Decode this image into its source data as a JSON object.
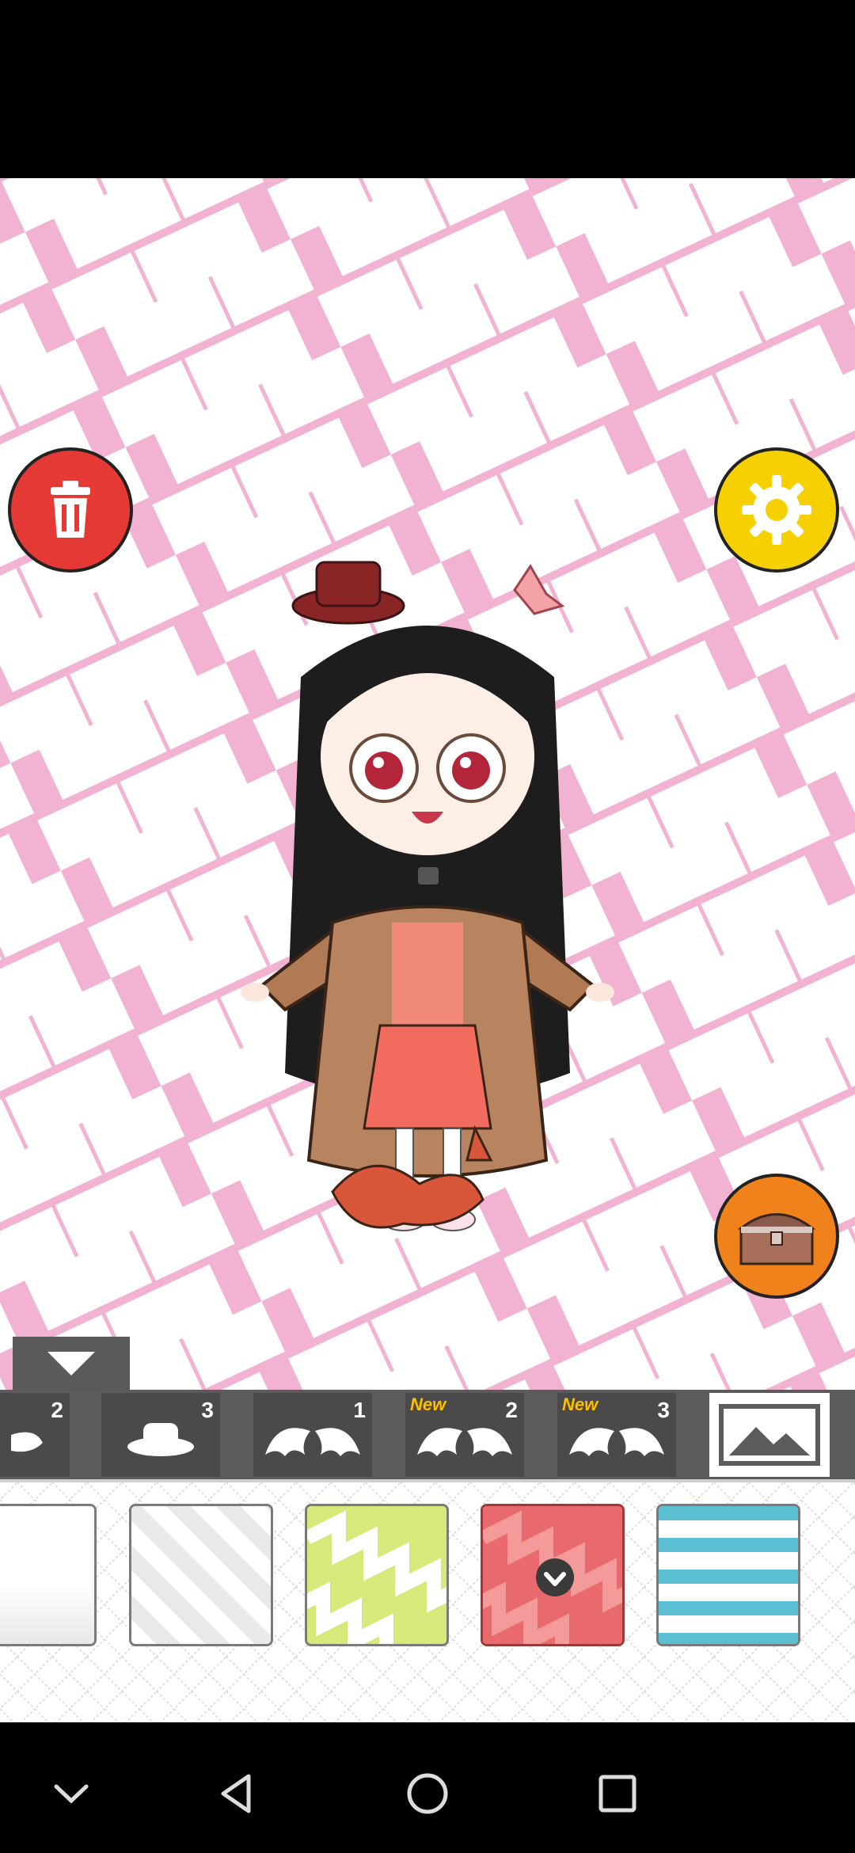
{
  "colors": {
    "background_pink": "#f1b3d1",
    "trash_red": "#e53935",
    "settings_yellow": "#f6d000",
    "chest_orange": "#f0821b",
    "bar_gray": "#5b5b5b"
  },
  "category_tabs": [
    {
      "icon": "bat-wing-partial-icon",
      "number": "2",
      "new": false
    },
    {
      "icon": "hat-icon",
      "number": "3",
      "new": false
    },
    {
      "icon": "bat-wings-icon",
      "number": "1",
      "new": false
    },
    {
      "icon": "bat-wings-icon",
      "number": "2",
      "new": true
    },
    {
      "icon": "bat-wings-icon",
      "number": "3",
      "new": true
    },
    {
      "icon": "background-image-icon",
      "number": "",
      "new": false,
      "active": true
    }
  ],
  "new_label": "New",
  "swatches": [
    {
      "pattern": "white-gradient"
    },
    {
      "pattern": "gray-diagonal-stripes"
    },
    {
      "pattern": "green-zigzag"
    },
    {
      "pattern": "red-zigzag",
      "selected": true
    },
    {
      "pattern": "blue-horizontal-stripes"
    }
  ],
  "buttons": {
    "trash": "trash-icon",
    "settings": "gear-icon",
    "chest": "treasure-chest-icon",
    "collapse": "triangle-down-icon"
  },
  "nav": [
    "chevron-down-icon",
    "back-triangle-icon",
    "home-circle-icon",
    "recents-square-icon"
  ]
}
